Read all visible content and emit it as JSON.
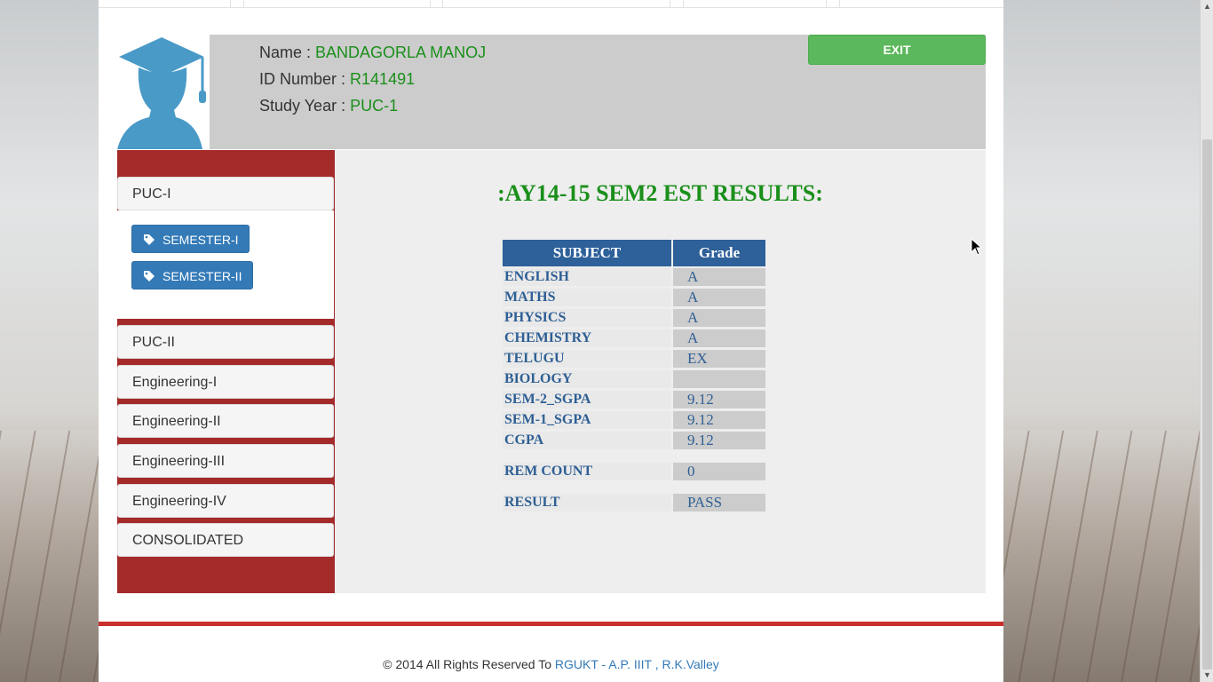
{
  "header": {
    "name_label": "Name : ",
    "name_value": "BANDAGORLA MANOJ",
    "id_label": "ID Number : ",
    "id_value": "R141491",
    "year_label": "Study Year : ",
    "year_value": "PUC-1",
    "exit_label": "EXIT"
  },
  "sidebar": {
    "puc1": "PUC-I",
    "sem1": "SEMESTER-I",
    "sem2": "SEMESTER-II",
    "items": [
      "PUC-II",
      "Engineering-I",
      "Engineering-II",
      "Engineering-III",
      "Engineering-IV",
      "CONSOLIDATED"
    ]
  },
  "results": {
    "title": ":AY14-15 SEM2 EST RESULTS:",
    "col_subject": "SUBJECT",
    "col_grade": "Grade",
    "rows": [
      {
        "subject": "ENGLISH",
        "grade": "A"
      },
      {
        "subject": "MATHS",
        "grade": "A"
      },
      {
        "subject": "PHYSICS",
        "grade": "A"
      },
      {
        "subject": "CHEMISTRY",
        "grade": "A"
      },
      {
        "subject": "TELUGU",
        "grade": "EX"
      },
      {
        "subject": "BIOLOGY",
        "grade": ""
      },
      {
        "subject": "SEM-2_SGPA",
        "grade": "9.12"
      },
      {
        "subject": "SEM-1_SGPA",
        "grade": "9.12"
      },
      {
        "subject": "CGPA",
        "grade": "9.12"
      }
    ],
    "rem_label": "REM COUNT",
    "rem_value": "0",
    "result_label": "RESULT",
    "result_value": "PASS"
  },
  "footer": {
    "text": "© 2014 All Rights Reserved To ",
    "link": "RGUKT - A.P. IIIT , R.K.Valley"
  },
  "colors": {
    "accent_green": "#1a8f1a",
    "exit_green": "#5cb85c",
    "sidebar_red": "#a52a2a",
    "button_blue": "#337ab7",
    "table_header_blue": "#2e6099"
  }
}
